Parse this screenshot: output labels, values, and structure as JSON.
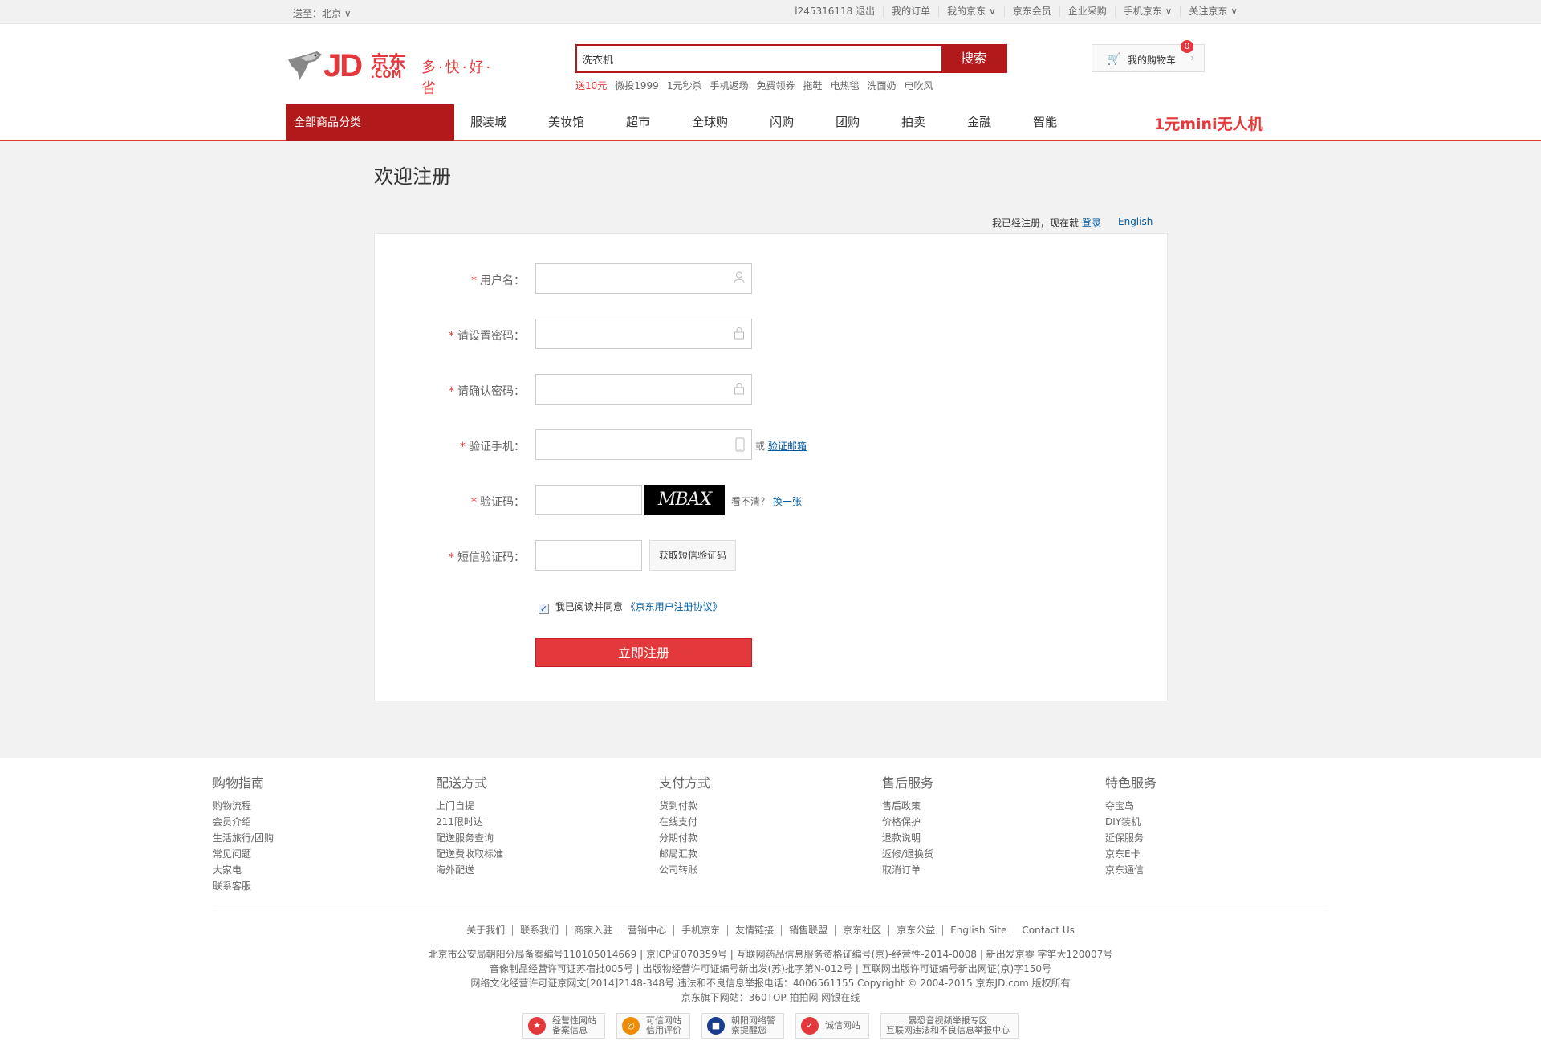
{
  "topbar": {
    "ship_to": "送至：北京 ∨",
    "links": [
      "l245316118  退出",
      "我的订单",
      "我的京东 ∨",
      "京东会员",
      "企业采购",
      "手机京东 ∨",
      "关注京东 ∨"
    ]
  },
  "logo": {
    "jd": "JD",
    "cn": "京东",
    "com": ".COM",
    "slogan": "多·快·好·省"
  },
  "search": {
    "value": "洗衣机",
    "button": "搜索",
    "hotwords": [
      "送10元",
      "微投1999",
      "1元秒杀",
      "手机返场",
      "免费领券",
      "拖鞋",
      "电热毯",
      "洗面奶",
      "电吹风"
    ]
  },
  "cart": {
    "label": "我的购物车",
    "count": "0"
  },
  "nav": {
    "category": "全部商品分类",
    "items": [
      "服装城",
      "美妆馆",
      "超市",
      "全球购",
      "闪购",
      "团购",
      "拍卖",
      "金融",
      "智能"
    ],
    "promo": "1元mini无人机"
  },
  "page": {
    "title": "欢迎注册",
    "already_text": "我已经注册，现在就",
    "login_link": "登录",
    "english": "English"
  },
  "form": {
    "username_label": "用户名：",
    "password_label": "请设置密码：",
    "confirm_label": "请确认密码：",
    "phone_label": "验证手机：",
    "phone_or": "或",
    "verify_email": "验证邮箱",
    "captcha_label": "验证码：",
    "captcha_text": "MBAX",
    "captcha_hint": "看不清？",
    "captcha_refresh": "换一张",
    "sms_label": "短信验证码：",
    "sms_button": "获取短信验证码",
    "agree_text": "我已阅读并同意",
    "agreement_link": "《京东用户注册协议》",
    "agree_checked": true,
    "submit": "立即注册"
  },
  "footer": {
    "columns": [
      {
        "title": "购物指南",
        "items": [
          "购物流程",
          "会员介绍",
          "生活旅行/团购",
          "常见问题",
          "大家电",
          "联系客服"
        ]
      },
      {
        "title": "配送方式",
        "items": [
          "上门自提",
          "211限时达",
          "配送服务查询",
          "配送费收取标准",
          "海外配送"
        ]
      },
      {
        "title": "支付方式",
        "items": [
          "货到付款",
          "在线支付",
          "分期付款",
          "邮局汇款",
          "公司转账"
        ]
      },
      {
        "title": "售后服务",
        "items": [
          "售后政策",
          "价格保护",
          "退款说明",
          "返修/退换货",
          "取消订单"
        ]
      },
      {
        "title": "特色服务",
        "items": [
          "夺宝岛",
          "DIY装机",
          "延保服务",
          "京东E卡",
          "京东通信"
        ]
      }
    ],
    "links": [
      "关于我们",
      "联系我们",
      "商家入驻",
      "营销中心",
      "手机京东",
      "友情链接",
      "销售联盟",
      "京东社区",
      "京东公益",
      "English Site",
      "Contact Us"
    ],
    "copy_lines": [
      "北京市公安局朝阳分局备案编号110105014669 | 京ICP证070359号 | 互联网药品信息服务资格证编号(京)-经营性-2014-0008 | 新出发京零 字第大120007号",
      "音像制品经营许可证苏宿批005号 | 出版物经营许可证编号新出发(苏)批字第N-012号 | 互联网出版许可证编号新出网证(京)字150号",
      "网络文化经营许可证京网文[2014]2148-348号  违法和不良信息举报电话：4006561155  Copyright © 2004-2015  京东JD.com 版权所有",
      "京东旗下网站：360TOP  拍拍网  网银在线"
    ],
    "badges": [
      {
        "line1": "经营性网站",
        "line2": "备案信息"
      },
      {
        "line1": "可信网站",
        "line2": "信用评价"
      },
      {
        "line1": "朝阳网络警",
        "line2": "察提醒您"
      },
      {
        "line1": "诚信网站",
        "line2": ""
      },
      {
        "line1": "暴恐音视频举报专区",
        "line2": "互联网违法和不良信息举报中心"
      }
    ]
  },
  "colors": {
    "brand_red": "#e4393c",
    "dark_red": "#b1191a",
    "link_blue": "#005aa0",
    "page_bg": "#f2f2f2"
  }
}
